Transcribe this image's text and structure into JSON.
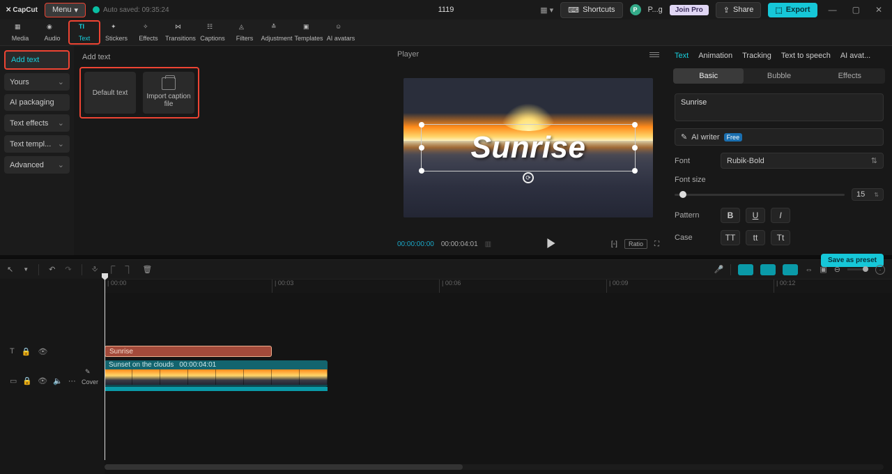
{
  "titlebar": {
    "app": "CapCut",
    "menu": "Menu",
    "autosave": "Auto saved: 09:35:24",
    "project": "1119",
    "shortcuts": "Shortcuts",
    "user": "P...g",
    "join_pro": "Join Pro",
    "share": "Share",
    "export": "Export"
  },
  "tooltabs": [
    "Media",
    "Audio",
    "Text",
    "Stickers",
    "Effects",
    "Transitions",
    "Captions",
    "Filters",
    "Adjustment",
    "Templates",
    "AI avatars"
  ],
  "tooltabs_active": "Text",
  "sidebar": {
    "header": "Add text",
    "items": [
      "Add text",
      "Yours",
      "AI packaging",
      "Text effects",
      "Text templ...",
      "Advanced"
    ],
    "active": "Add text"
  },
  "library": {
    "title": "Add text",
    "cards": [
      "Default text",
      "Import caption file"
    ]
  },
  "player": {
    "label": "Player",
    "text_content": "Sunrise",
    "time_current": "00:00:00:00",
    "time_total": "00:00:04:01",
    "ratio": "Ratio"
  },
  "inspector": {
    "tabs": [
      "Text",
      "Animation",
      "Tracking",
      "Text to speech",
      "AI avat..."
    ],
    "tab_active": "Text",
    "subtabs": [
      "Basic",
      "Bubble",
      "Effects"
    ],
    "subtab_active": "Basic",
    "text_value": "Sunrise",
    "ai_writer": "AI writer",
    "ai_badge": "Free",
    "font_label": "Font",
    "font_value": "Rubik-Bold",
    "fontsize_label": "Font size",
    "fontsize_value": "15",
    "pattern_label": "Pattern",
    "case_label": "Case",
    "case_opts": [
      "TT",
      "tt",
      "Tt"
    ],
    "save_preset": "Save as preset"
  },
  "timeline": {
    "marks": [
      "00:00",
      "00:03",
      "00:06",
      "00:09",
      "00:12"
    ],
    "text_clip": "Sunrise",
    "video_name": "Sunset on the clouds",
    "video_dur": "00:00:04:01",
    "cover": "Cover"
  }
}
